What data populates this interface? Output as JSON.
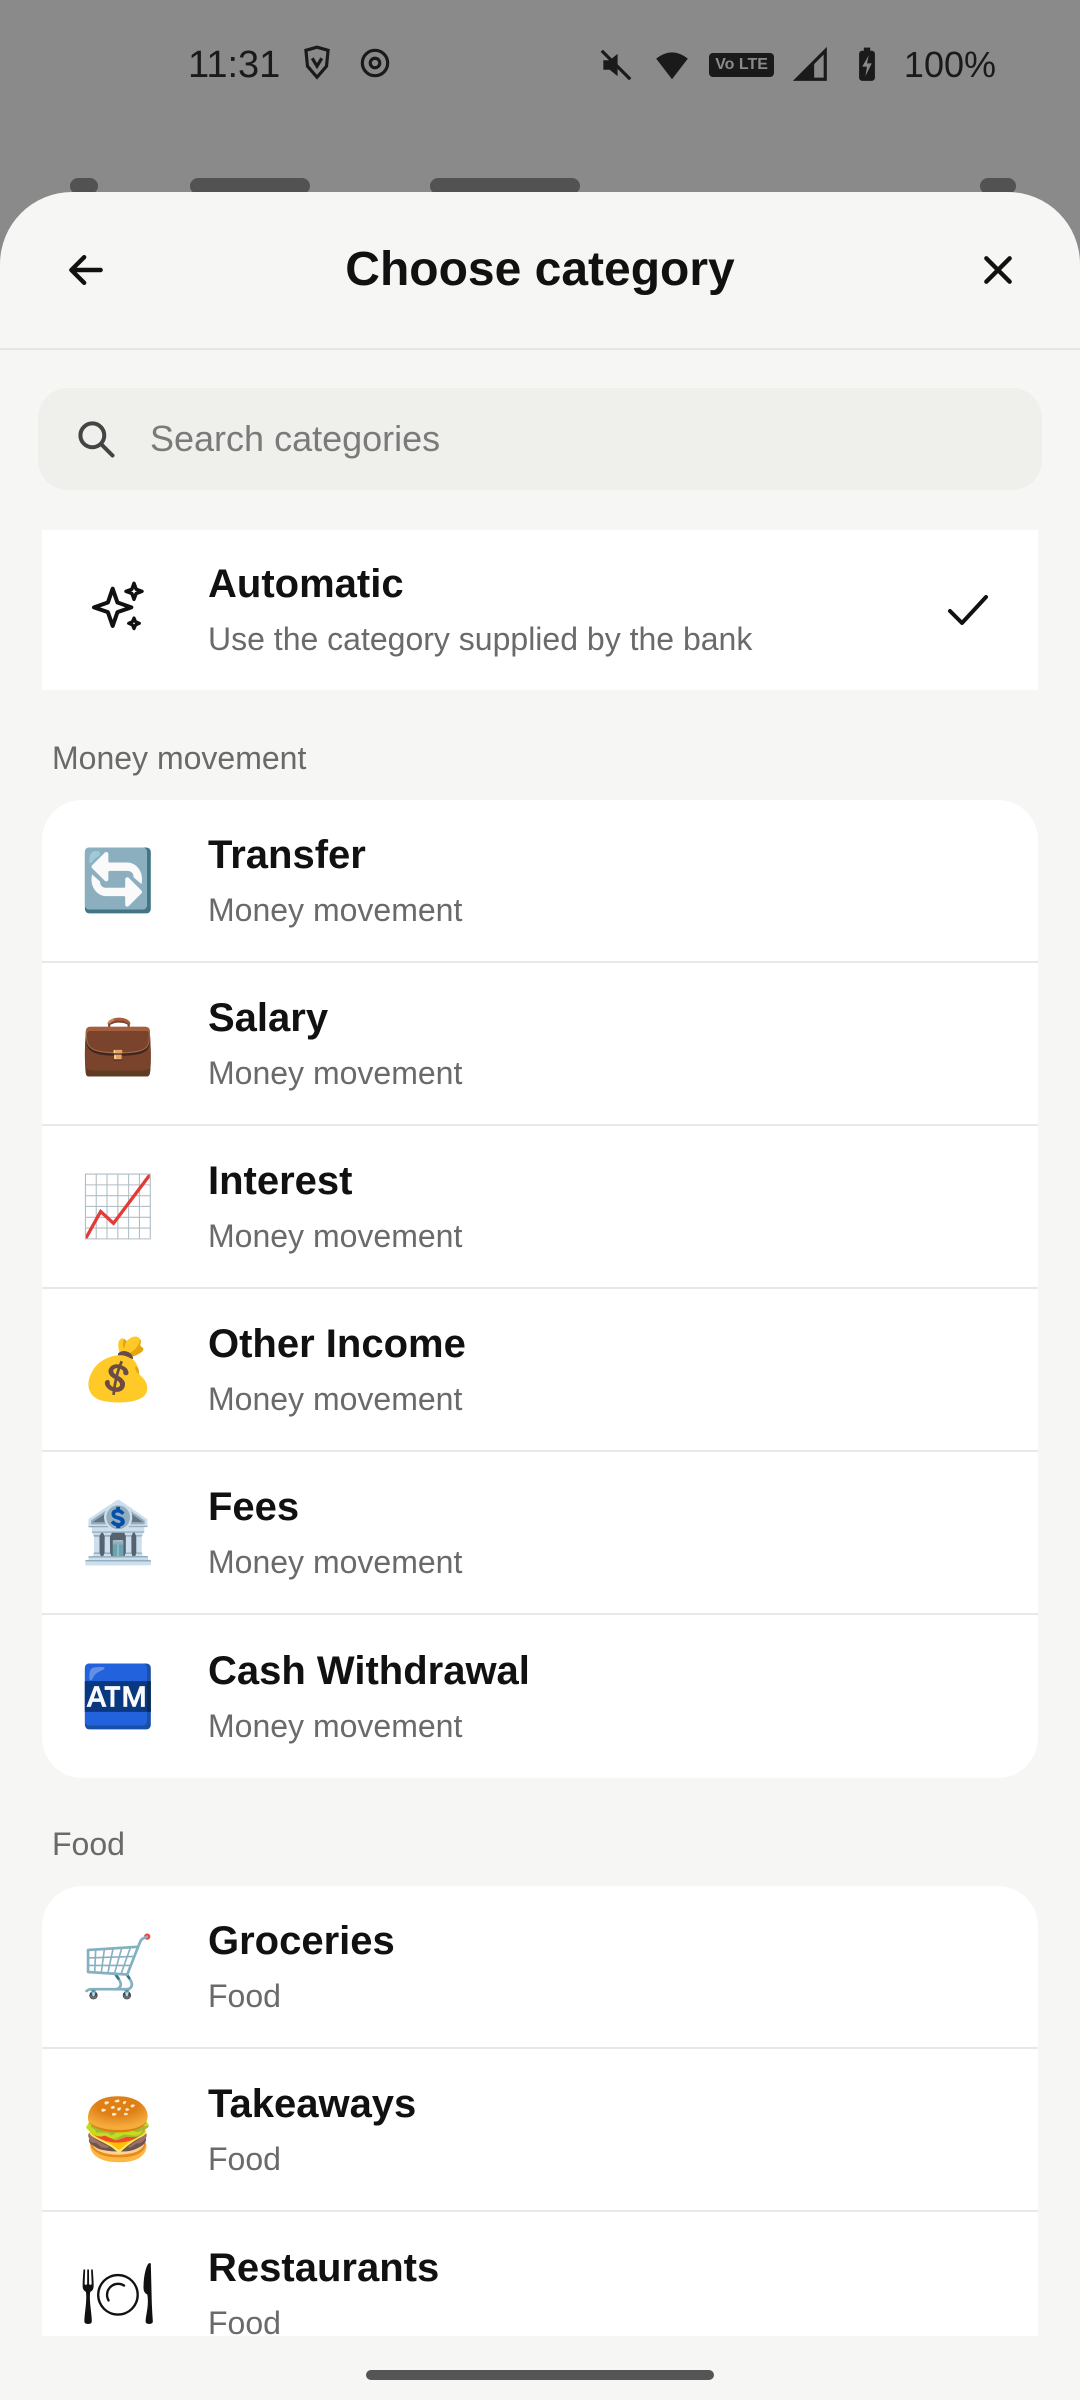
{
  "status_bar": {
    "time": "11:31",
    "battery": "100%",
    "volte": "Vo LTE"
  },
  "sheet": {
    "title": "Choose category",
    "search_placeholder": "Search categories"
  },
  "automatic": {
    "title": "Automatic",
    "subtitle": "Use the category supplied by the bank",
    "selected": true
  },
  "sections": [
    {
      "label": "Money movement",
      "items": [
        {
          "title": "Transfer",
          "subtitle": "Money movement",
          "icon": "🔄"
        },
        {
          "title": "Salary",
          "subtitle": "Money movement",
          "icon": "💼"
        },
        {
          "title": "Interest",
          "subtitle": "Money movement",
          "icon": "📈"
        },
        {
          "title": "Other Income",
          "subtitle": "Money movement",
          "icon": "💰"
        },
        {
          "title": "Fees",
          "subtitle": "Money movement",
          "icon": "🏦"
        },
        {
          "title": "Cash Withdrawal",
          "subtitle": "Money movement",
          "icon": "🏧"
        }
      ]
    },
    {
      "label": "Food",
      "items": [
        {
          "title": "Groceries",
          "subtitle": "Food",
          "icon": "🛒"
        },
        {
          "title": "Takeaways",
          "subtitle": "Food",
          "icon": "🍔"
        },
        {
          "title": "Restaurants",
          "subtitle": "Food",
          "icon": "🍽"
        }
      ]
    }
  ],
  "colors": {
    "sheet_bg": "#f6f6f4",
    "card_bg": "#ffffff",
    "search_bg": "#efefec",
    "backdrop": "#8a8a8a"
  }
}
